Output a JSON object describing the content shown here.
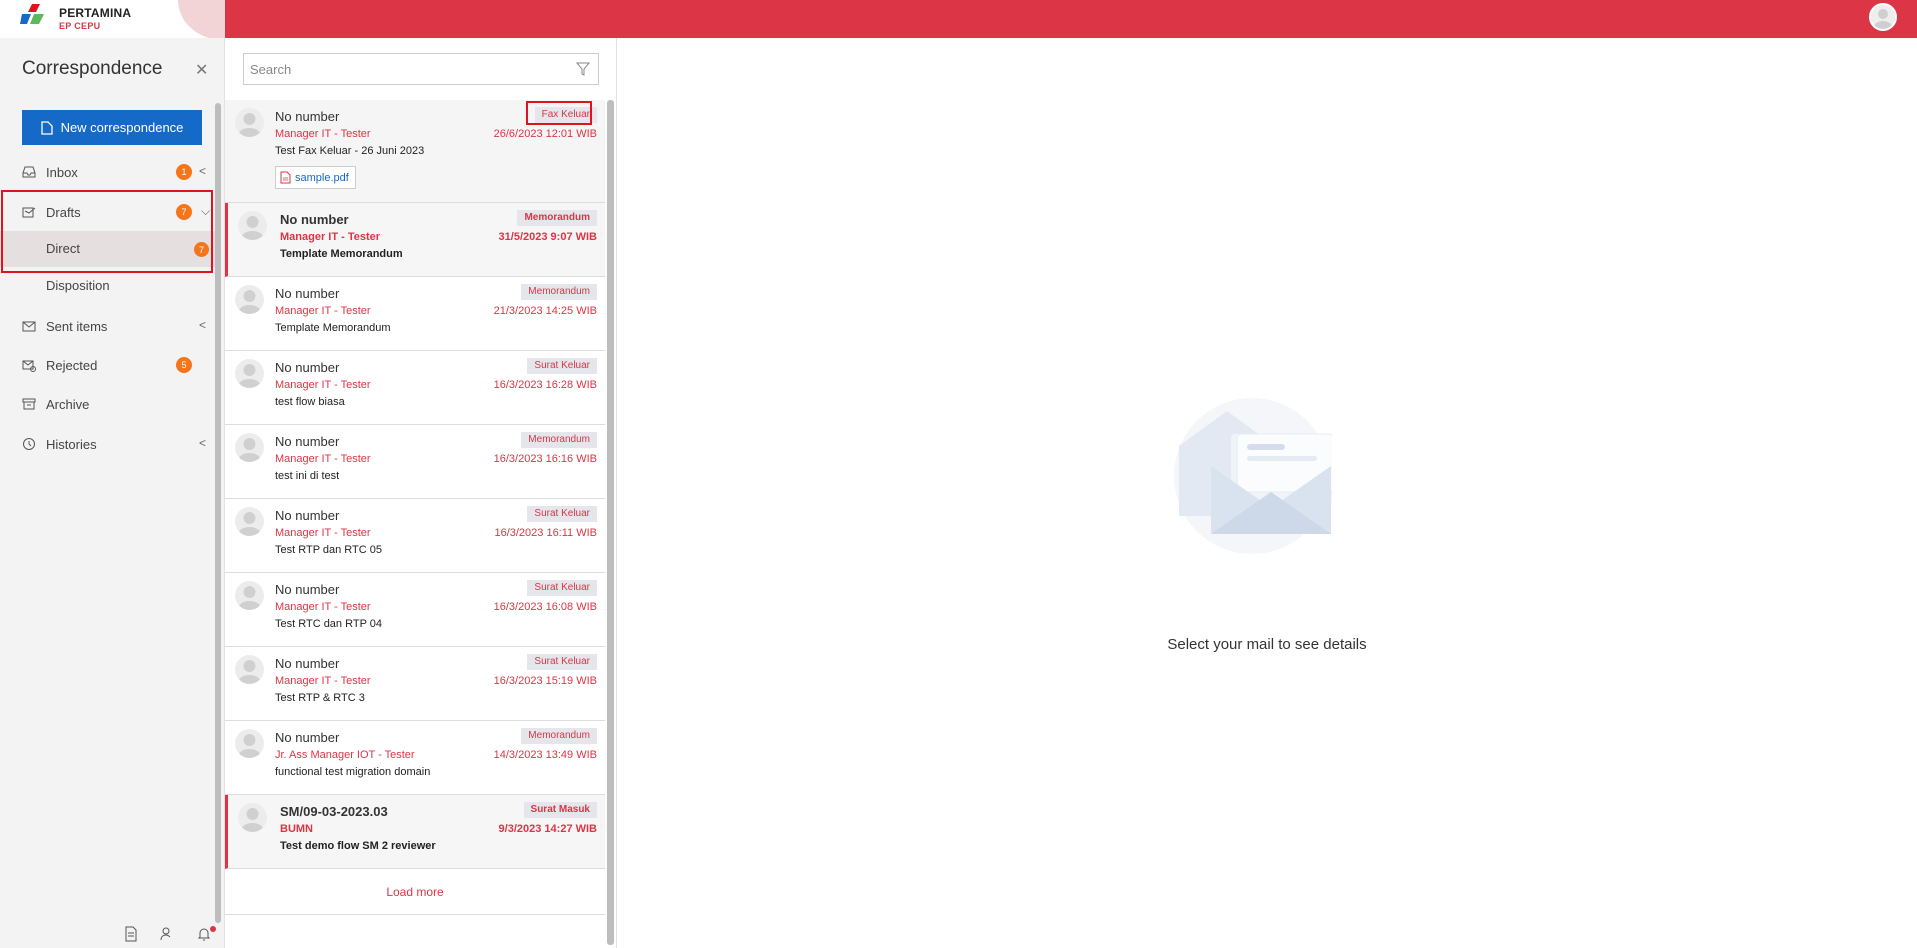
{
  "header": {
    "logo_name": "PERTAMINA",
    "logo_sub": "EP CEPU"
  },
  "sidebar": {
    "title": "Correspondence",
    "new_button_label": "New correspondence",
    "items": [
      {
        "label": "Inbox",
        "badge": "1",
        "icon": "inbox-icon"
      },
      {
        "label": "Drafts",
        "badge": "7",
        "icon": "drafts-icon"
      },
      {
        "label": "Direct",
        "badge": "7"
      },
      {
        "label": "Disposition"
      },
      {
        "label": "Sent items",
        "icon": "sent-icon"
      },
      {
        "label": "Rejected",
        "badge": "5",
        "icon": "rejected-icon"
      },
      {
        "label": "Archive",
        "icon": "archive-icon"
      },
      {
        "label": "Histories",
        "icon": "history-icon"
      }
    ]
  },
  "search": {
    "placeholder": "Search"
  },
  "mails": [
    {
      "number": "No number",
      "sender": "Manager IT - Tester",
      "subject": "Test Fax Keluar - 26 Juni 2023",
      "tag": "Fax Keluar",
      "date": "26/6/2023 12:01 WIB",
      "attachment": "sample.pdf"
    },
    {
      "number": "No number",
      "sender": "Manager IT - Tester",
      "subject": "Template Memorandum",
      "tag": "Memorandum",
      "date": "31/5/2023 9:07 WIB"
    },
    {
      "number": "No number",
      "sender": "Manager IT - Tester",
      "subject": "Template Memorandum",
      "tag": "Memorandum",
      "date": "21/3/2023 14:25 WIB"
    },
    {
      "number": "No number",
      "sender": "Manager IT - Tester",
      "subject": "test flow biasa",
      "tag": "Surat Keluar",
      "date": "16/3/2023 16:28 WIB"
    },
    {
      "number": "No number",
      "sender": "Manager IT - Tester",
      "subject": "test ini di test",
      "tag": "Memorandum",
      "date": "16/3/2023 16:16 WIB"
    },
    {
      "number": "No number",
      "sender": "Manager IT - Tester",
      "subject": "Test RTP dan RTC 05",
      "tag": "Surat Keluar",
      "date": "16/3/2023 16:11 WIB"
    },
    {
      "number": "No number",
      "sender": "Manager IT - Tester",
      "subject": "Test RTC dan RTP 04",
      "tag": "Surat Keluar",
      "date": "16/3/2023 16:08 WIB"
    },
    {
      "number": "No number",
      "sender": "Manager IT - Tester",
      "subject": "Test RTP & RTC 3",
      "tag": "Surat Keluar",
      "date": "16/3/2023 15:19 WIB"
    },
    {
      "number": "No number",
      "sender": "Jr. Ass Manager IOT - Tester",
      "subject": "functional test migration domain",
      "tag": "Memorandum",
      "date": "14/3/2023 13:49 WIB"
    },
    {
      "number": "SM/09-03-2023.03",
      "sender": "BUMN",
      "subject": "Test demo flow SM 2 reviewer",
      "tag": "Surat Masuk",
      "date": "9/3/2023 14:27 WIB"
    }
  ],
  "load_more": "Load more",
  "detail": {
    "empty_text": "Select your mail to see details"
  },
  "colors": {
    "brand_red": "#dc3545",
    "primary_blue": "#1569c7",
    "badge_orange": "#f5761a"
  }
}
